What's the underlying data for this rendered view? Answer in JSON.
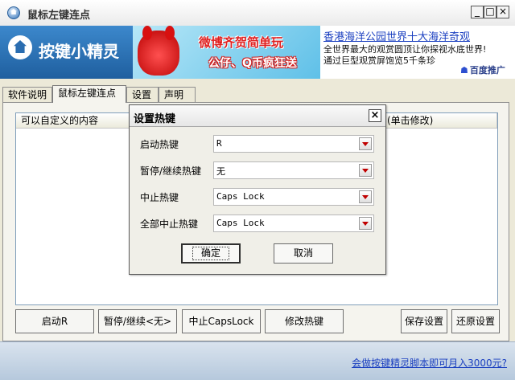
{
  "window": {
    "title": "鼠标左键连点",
    "min_glyph": "_",
    "max_glyph": "□",
    "close_glyph": "×"
  },
  "header": {
    "logo_text": "按键小精灵",
    "banner": {
      "line1": "微博齐贺简单玩",
      "line2": "公仔、Q币疯狂送"
    },
    "ad": {
      "title": "香港海洋公园世界十大海洋奇观",
      "line1": "全世界最大的观赏圆顶让你探视水底世界!",
      "line2": "通过巨型观赏屏饱览5千条珍",
      "brand": "百度推广",
      "brand_icon": "paw-icon"
    }
  },
  "tabs": [
    {
      "label": "软件说明"
    },
    {
      "label": "鼠标左键连点",
      "active": true
    },
    {
      "label": "设置"
    },
    {
      "label": "声明"
    }
  ],
  "list": {
    "columns": [
      "可以自定义的内容",
      "(单击修改)"
    ]
  },
  "buttons": {
    "start": "启动R",
    "pause": "暂停/继续<无>",
    "stop": "中止CapsLock",
    "modify": "修改热键",
    "save": "保存设置",
    "restore": "还原设置"
  },
  "footer": {
    "link": "会做按键精灵脚本即可月入3000元?"
  },
  "dialog": {
    "title": "设置热键",
    "close_glyph": "×",
    "rows": [
      {
        "label": "启动热键",
        "value": "R"
      },
      {
        "label": "暂停/继续热键",
        "value": "无"
      },
      {
        "label": "中止热键",
        "value": "Caps Lock"
      },
      {
        "label": "全部中止热键",
        "value": "Caps Lock"
      }
    ],
    "ok": "确定",
    "cancel": "取消"
  },
  "colors": {
    "accent_blue": "#2a6db0",
    "link_blue": "#1a3fc0",
    "dropdown_arrow": "#c00000"
  }
}
